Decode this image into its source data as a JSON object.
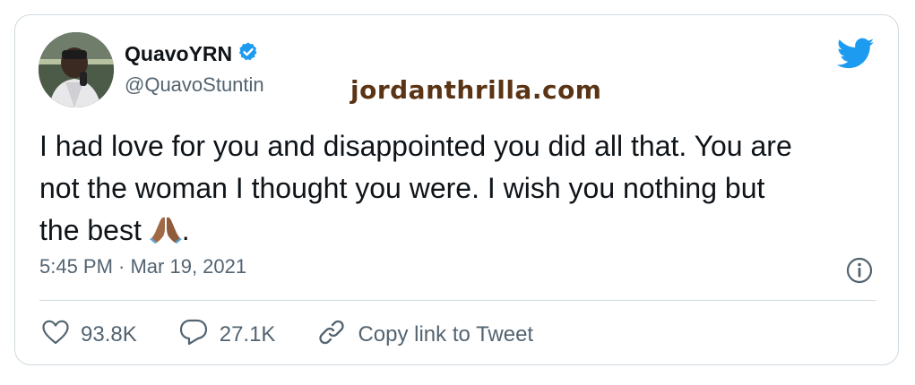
{
  "user": {
    "display_name": "QuavoYRN",
    "handle": "@QuavoStuntin",
    "verified": true
  },
  "watermark": "jordanthrilla.com",
  "tweet": {
    "lines": [
      "I had love for you and disappointed you did all that. You are",
      "not the woman I thought you were.  I wish you nothing but",
      "the best"
    ],
    "emoji": "folded-hands",
    "trailing": "."
  },
  "timestamp": "5:45 PM · Mar 19, 2021",
  "actions": {
    "likes": "93.8K",
    "replies": "27.1K",
    "copy_link": "Copy link to Tweet"
  },
  "colors": {
    "brand_blue": "#1d9bf0",
    "text": "#0f1419",
    "secondary": "#536471",
    "border": "#cfd9de",
    "watermark": "#5a3414"
  },
  "icons": [
    "verified-badge-icon",
    "twitter-bird-icon",
    "info-icon",
    "heart-icon",
    "reply-icon",
    "link-icon",
    "folded-hands-emoji"
  ]
}
